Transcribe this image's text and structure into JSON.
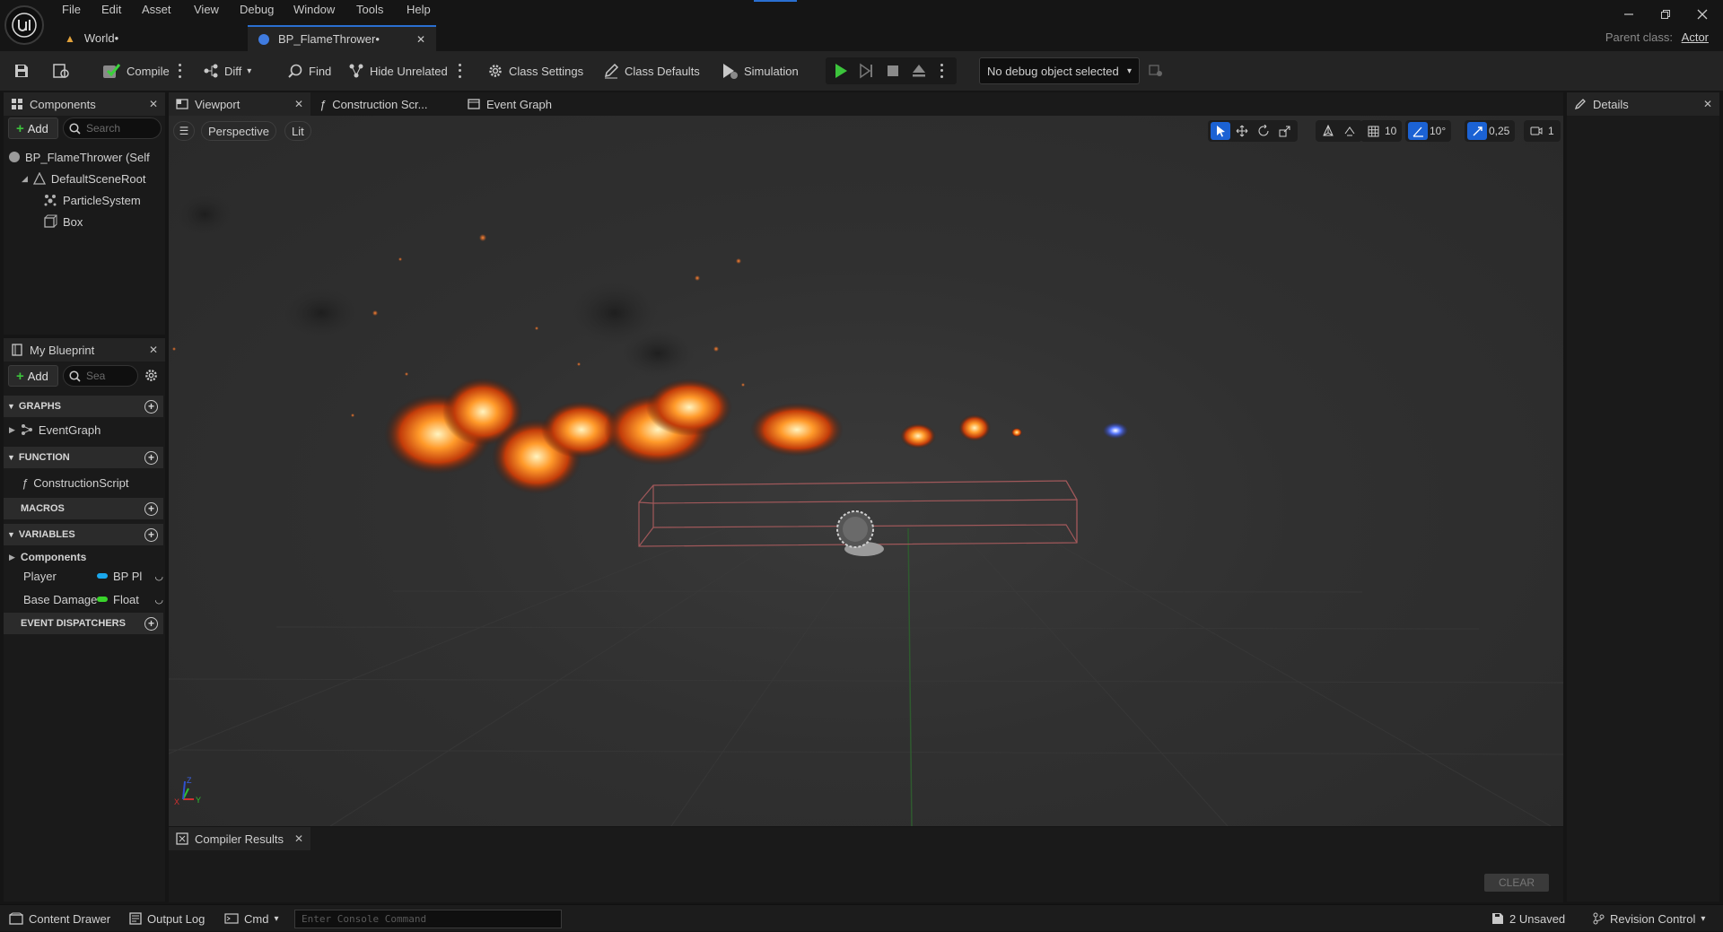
{
  "menu": [
    "File",
    "Edit",
    "Asset",
    "View",
    "Debug",
    "Window",
    "Tools",
    "Help"
  ],
  "doc_tabs": [
    {
      "label": "World•"
    },
    {
      "label": "BP_FlameThrower•"
    }
  ],
  "parent_class": {
    "label": "Parent class:",
    "value": "Actor"
  },
  "toolbar": {
    "compile": "Compile",
    "diff": "Diff",
    "find": "Find",
    "hide_unrelated": "Hide Unrelated",
    "class_settings": "Class Settings",
    "class_defaults": "Class Defaults",
    "simulation": "Simulation",
    "debug_object": "No debug object selected"
  },
  "components_panel": {
    "title": "Components",
    "add": "Add",
    "search_placeholder": "Search",
    "items": [
      {
        "label": "BP_FlameThrower (Self"
      },
      {
        "label": "DefaultSceneRoot"
      },
      {
        "label": "ParticleSystem"
      },
      {
        "label": "Box"
      }
    ]
  },
  "blueprint_panel": {
    "title": "My Blueprint",
    "add": "Add",
    "search_placeholder": "Sea",
    "sections": {
      "graphs": "GRAPHS",
      "function": "FUNCTION",
      "macros": "MACROS",
      "variables": "VARIABLES",
      "event_dispatchers": "EVENT DISPATCHERS"
    },
    "event_graph": "EventGraph",
    "construction_script": "ConstructionScript",
    "components_category": "Components",
    "variables": [
      {
        "name": "Player",
        "type": "BP Pl",
        "color": "#1aa7ec"
      },
      {
        "name": "Base Damage",
        "type": "Float",
        "color": "#39d42b"
      }
    ]
  },
  "editor_tabs": [
    {
      "label": "Viewport"
    },
    {
      "label": "Construction Scr..."
    },
    {
      "label": "Event Graph"
    }
  ],
  "viewport": {
    "view_mode": "Perspective",
    "lighting": "Lit",
    "grid_snap": "10",
    "rotation_snap": "10°",
    "scale_snap": "0,25",
    "camera_speed": "1"
  },
  "details_panel": {
    "title": "Details"
  },
  "compiler": {
    "title": "Compiler Results",
    "clear": "CLEAR"
  },
  "status_bar": {
    "content_drawer": "Content Drawer",
    "output_log": "Output Log",
    "cmd": "Cmd",
    "console_placeholder": "Enter Console Command",
    "unsaved": "2 Unsaved",
    "revision_control": "Revision Control"
  }
}
